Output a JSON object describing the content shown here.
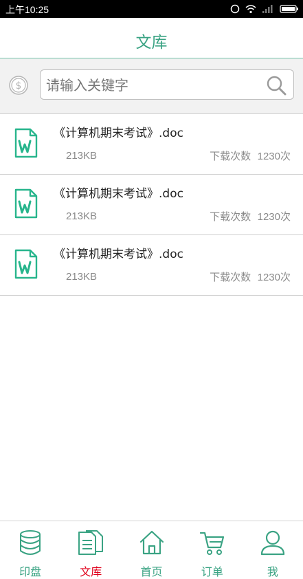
{
  "status_bar": {
    "time": "上午10:25",
    "icons": [
      "alarm-icon",
      "wifi-icon",
      "signal-icon",
      "battery-icon"
    ]
  },
  "header": {
    "title": "文库"
  },
  "search": {
    "placeholder": "请输入关键字",
    "value": "",
    "left_icon": "coin-icon",
    "right_icon": "search-icon"
  },
  "documents": [
    {
      "name": "《计算机期末考试》.doc",
      "size": "213KB",
      "downloads_label": "下载次数",
      "downloads": "1230次"
    },
    {
      "name": "《计算机期末考试》.doc",
      "size": "213KB",
      "downloads_label": "下载次数",
      "downloads": "1230次"
    },
    {
      "name": "《计算机期末考试》.doc",
      "size": "213KB",
      "downloads_label": "下载次数",
      "downloads": "1230次"
    }
  ],
  "tabs": [
    {
      "label": "印盘",
      "icon": "database-icon",
      "active": false
    },
    {
      "label": "文库",
      "icon": "documents-icon",
      "active": true
    },
    {
      "label": "首页",
      "icon": "home-icon",
      "active": false
    },
    {
      "label": "订单",
      "icon": "cart-icon",
      "active": false
    },
    {
      "label": "我",
      "icon": "user-icon",
      "active": false
    }
  ],
  "colors": {
    "accent": "#3aa383",
    "active_tab": "#e0001b",
    "status_bar": "#000000"
  }
}
